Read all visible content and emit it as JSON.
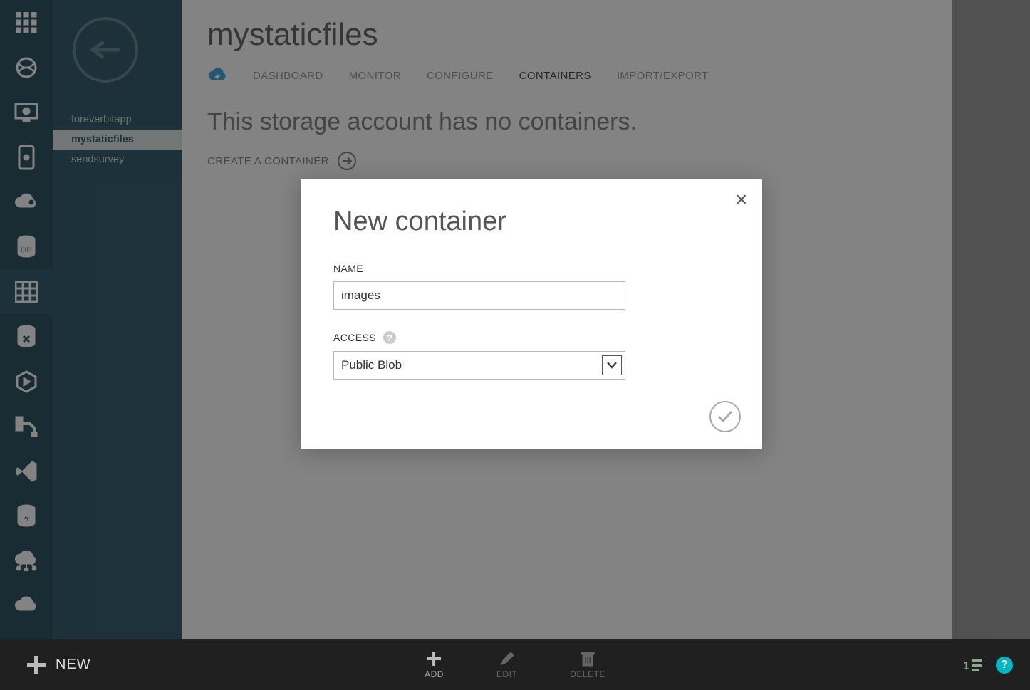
{
  "sidebar_items": [
    {
      "name": "foreverbitapp",
      "selected": false
    },
    {
      "name": "mystaticfiles",
      "selected": true
    },
    {
      "name": "sendsurvey",
      "selected": false
    }
  ],
  "page": {
    "title": "mystaticfiles",
    "tabs": [
      "DASHBOARD",
      "MONITOR",
      "CONFIGURE",
      "CONTAINERS",
      "IMPORT/EXPORT"
    ],
    "active_tab": "CONTAINERS",
    "empty_message": "This storage account has no containers.",
    "create_label": "CREATE A CONTAINER"
  },
  "modal": {
    "title": "New container",
    "name_label": "NAME",
    "name_value": "images",
    "access_label": "ACCESS",
    "access_value": "Public Blob"
  },
  "commandbar": {
    "new": "NEW",
    "add": "ADD",
    "edit": "EDIT",
    "delete": "DELETE"
  }
}
